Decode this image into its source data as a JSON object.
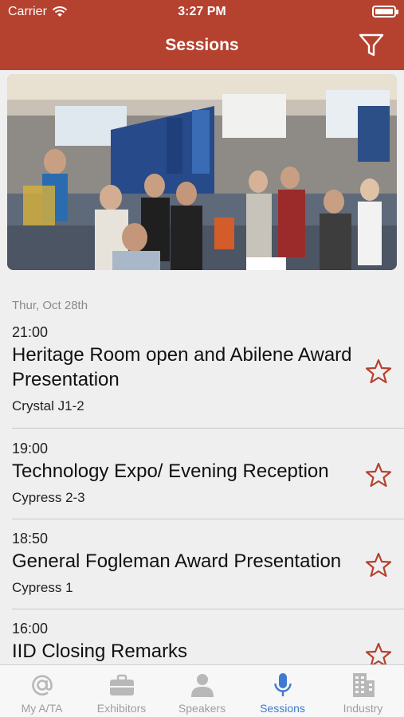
{
  "status_bar": {
    "carrier": "Carrier",
    "time": "3:27 PM"
  },
  "nav": {
    "title": "Sessions",
    "filter_icon": "filter-icon"
  },
  "colors": {
    "header": "#b5412f",
    "star": "#b5412f",
    "active_tab": "#3f7ad0",
    "inactive_tab": "#9d9d9d"
  },
  "date_header": "Thur, Oct 28th",
  "sessions": [
    {
      "time": "21:00",
      "title": "Heritage Room open and Abilene Award Presentation",
      "room": "Crystal J1-2",
      "starred": false
    },
    {
      "time": "19:00",
      "title": "Technology Expo/ Evening Reception",
      "room": "Cypress 2-3",
      "starred": false
    },
    {
      "time": "18:50",
      "title": "General Fogleman Award Presentation",
      "room": "Cypress 1",
      "starred": false
    },
    {
      "time": "16:00",
      "title": "IID Closing Remarks",
      "room": "",
      "starred": false
    }
  ],
  "tabs": [
    {
      "label": "My A/TA",
      "icon": "at-sign-icon",
      "active": false
    },
    {
      "label": "Exhibitors",
      "icon": "briefcase-icon",
      "active": false
    },
    {
      "label": "Speakers",
      "icon": "person-icon",
      "active": false
    },
    {
      "label": "Sessions",
      "icon": "microphone-icon",
      "active": true
    },
    {
      "label": "Industry",
      "icon": "building-icon",
      "active": false
    }
  ]
}
